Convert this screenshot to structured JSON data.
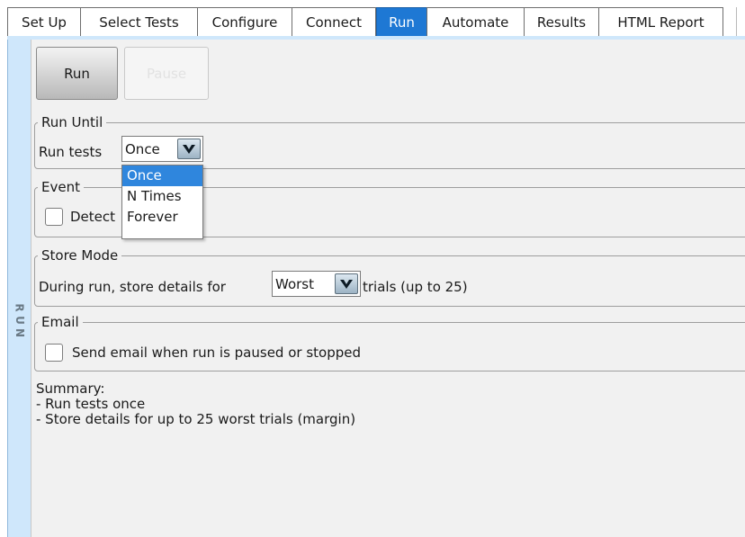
{
  "tabs": [
    {
      "label": "Set Up",
      "active": false
    },
    {
      "label": "Select Tests",
      "active": false
    },
    {
      "label": "Configure",
      "active": false
    },
    {
      "label": "Connect",
      "active": false
    },
    {
      "label": "Run",
      "active": true
    },
    {
      "label": "Automate",
      "active": false
    },
    {
      "label": "Results",
      "active": false
    },
    {
      "label": "HTML Report",
      "active": false
    }
  ],
  "side_label": [
    "R",
    "U",
    "N"
  ],
  "buttons": {
    "run": "Run",
    "pause": "Pause"
  },
  "run_until": {
    "legend": "Run Until",
    "label": "Run tests",
    "selected": "Once",
    "options": [
      "Once",
      "N Times",
      "Forever"
    ],
    "highlighted": "Once"
  },
  "event": {
    "legend": "Event",
    "checkbox_label": "Detect",
    "checked": false
  },
  "store_mode": {
    "legend": "Store Mode",
    "prefix": "During run, store details for",
    "selected": "Worst",
    "suffix": "trials (up to 25)"
  },
  "email": {
    "legend": "Email",
    "checkbox_label": "Send email when run is paused or stopped",
    "checked": false
  },
  "summary": {
    "title": "Summary:",
    "lines": [
      "- Run tests once",
      "- Store details for up to 25 worst trials (margin)"
    ]
  },
  "colors": {
    "active_tab": "#1e78d4",
    "highlight": "#2f86dd",
    "side_strip": "#cfe7fb",
    "panel": "#f1f1f1"
  },
  "icons": {
    "combo_arrow": "chevron-down-icon"
  }
}
